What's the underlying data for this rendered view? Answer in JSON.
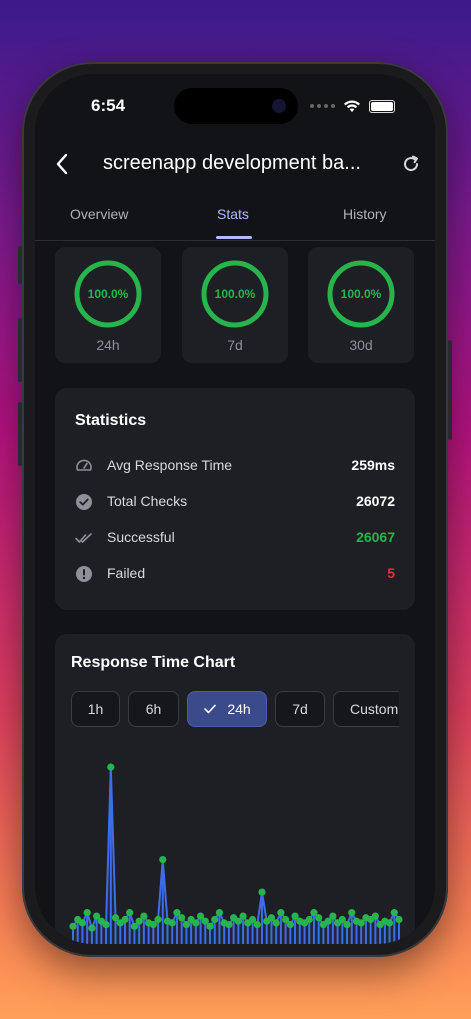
{
  "status_bar": {
    "time": "6:54"
  },
  "header": {
    "title": "screenapp development ba..."
  },
  "tabs": [
    {
      "label": "Overview"
    },
    {
      "label": "Stats"
    },
    {
      "label": "History"
    }
  ],
  "uptime": [
    {
      "percent": "100.0%",
      "period": "24h"
    },
    {
      "percent": "100.0%",
      "period": "7d"
    },
    {
      "percent": "100.0%",
      "period": "30d"
    }
  ],
  "statistics": {
    "title": "Statistics",
    "rows": [
      {
        "icon": "speedometer-icon",
        "label": "Avg Response Time",
        "value": "259ms",
        "color": "#ffffff"
      },
      {
        "icon": "check-circle-icon",
        "label": "Total Checks",
        "value": "26072",
        "color": "#ffffff"
      },
      {
        "icon": "double-check-icon",
        "label": "Successful",
        "value": "26067",
        "color": "#28b44c"
      },
      {
        "icon": "alert-circle-icon",
        "label": "Failed",
        "value": "5",
        "color": "#e0333c"
      }
    ]
  },
  "response_chart": {
    "title": "Response Time Chart",
    "ranges": [
      {
        "label": "1h",
        "selected": false
      },
      {
        "label": "6h",
        "selected": false
      },
      {
        "label": "24h",
        "selected": true
      },
      {
        "label": "7d",
        "selected": false
      },
      {
        "label": "Custom",
        "selected": false
      }
    ]
  },
  "colors": {
    "accent": "#3a4a8a",
    "success": "#28b44c",
    "danger": "#e0333c",
    "line": "#3d6ee8"
  },
  "chart_data": {
    "type": "line",
    "title": "",
    "xlabel": "",
    "ylabel": "",
    "grid": false,
    "legend": "none",
    "series": [
      {
        "values": [
          220,
          260,
          240,
          300,
          210,
          280,
          250,
          230,
          1150,
          270,
          240,
          260,
          300,
          220,
          250,
          280,
          240,
          230,
          260,
          610,
          250,
          240,
          300,
          270,
          230,
          260,
          240,
          280,
          250,
          220,
          260,
          300,
          240,
          230,
          270,
          250,
          280,
          240,
          260,
          230,
          420,
          250,
          270,
          240,
          300,
          260,
          230,
          280,
          250,
          240,
          260,
          300,
          270,
          230,
          250,
          280,
          240,
          260,
          230,
          300,
          250,
          240,
          270,
          260,
          280,
          230,
          250,
          240,
          300,
          260
        ]
      }
    ],
    "ylim": [
      0,
      1250
    ]
  }
}
